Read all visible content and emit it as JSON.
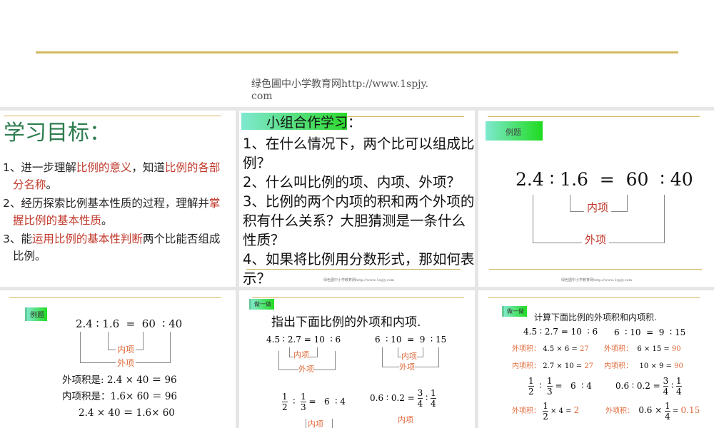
{
  "header": {
    "watermark_line1": "绿色圃中小学教育网http://www.1spjy.",
    "watermark_line2": "com"
  },
  "slide1": {
    "title": "学习目标：",
    "items": [
      {
        "n": "1",
        "a": "、进一步理解",
        "b": "比例的意义",
        "c": "，知道",
        "d": "比例的各部分名称",
        "e": "。"
      },
      {
        "n": "2",
        "a": "、经历探索比例基本性质的过程，理解并",
        "b": "掌握比例的基本性质",
        "c": "。"
      },
      {
        "n": "3",
        "a": "、能",
        "b": "运用比例的基本性判断",
        "c": "两个比能否组成比例。"
      }
    ]
  },
  "slide2": {
    "tag": "小组合作学",
    "tag_rest": "习：",
    "questions": [
      "1、在什么情况下，两个比可以组成比例？",
      "2、什么叫比例的项、内项、外项？",
      "3、比例的两个内项的积和两个外项的积有什么关系？大胆猜测是一条什么性质？",
      "4、如果将比例用分数形式，那如何表示？"
    ],
    "watermark": "绿色圃中小学教育网http://www.1spjy.com"
  },
  "slide3": {
    "tag": "例题",
    "equation": "2.4 ∶ 1.6  =  60  ∶ 40",
    "inner": "内项",
    "outer": "外项",
    "watermark": "绿色圃中小学教育网http://www.1spjy.com"
  },
  "slide4": {
    "tag": "例题",
    "equation": "2.4 ∶ 1.6  =  60  ∶ 40",
    "inner": "内项",
    "outer": "外项",
    "line1": "外项积是: 2.4 × 40  ＝  96",
    "line2": "内项积是：1.6× 60 ＝ 96",
    "line3": "2.4 × 40 ＝  1.6× 60"
  },
  "slide5": {
    "tag": "做一做",
    "title": "指出下面比例的外项和内项.",
    "eq1": "4.5 ∶ 2.7 = 10  ∶ 6",
    "eq2": "6  ∶ 10  =  9  ∶ 15",
    "eq3_rest": "=   6  ∶ 4",
    "eq4_left": "0.6  ∶ 0.2  =",
    "inner": "内项",
    "outer": "外项",
    "one": "1",
    "two": "2",
    "three": "3",
    "four": "4"
  },
  "slide6": {
    "tag": "做一做",
    "title": "计算下面比例的外项积和内项积.",
    "eq1": "4.5 ∶ 2.7 = 10  ∶ 6",
    "eq2": "6  ∶ 10  =  9  ∶ 15",
    "outer_label": "外项积：",
    "inner_label": "内项积：",
    "r1a": "4.5 × 6 = ",
    "r1a_v": "27",
    "r1b": "6 × 15 = ",
    "r1b_v": "90",
    "r2a": "2.7 × 10 = ",
    "r2a_v": "27",
    "r2b": "10 × 9 = ",
    "r2b_v": "90",
    "eq3_rest": "=   6  ∶ 4",
    "eq4_left": "0.6  ∶ 0.2  =",
    "r3a": "× 4 = ",
    "r3a_v": "2",
    "r3b": "0.6 × ",
    "r3b_eq": " = ",
    "r3b_v": "0.15",
    "one": "1",
    "two": "2",
    "three": "3",
    "four": "4"
  }
}
